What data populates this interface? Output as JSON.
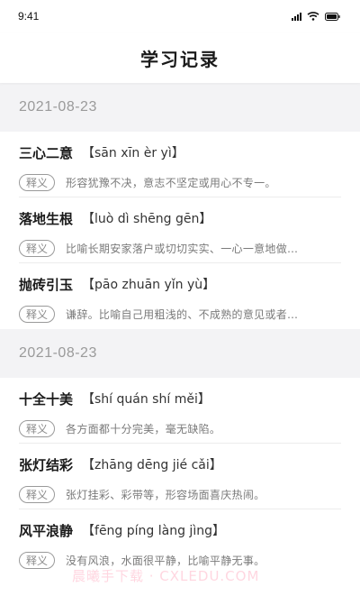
{
  "status_bar": {
    "time": "9:41",
    "icons": [
      "signal-icon",
      "wifi-icon",
      "battery-icon"
    ]
  },
  "header": {
    "title": "学习记录"
  },
  "sections": [
    {
      "date": "2021-08-23",
      "records": [
        {
          "word": "三心二意",
          "pinyin": "【sān xīn èr yì】",
          "tag": "释义",
          "definition": "形容犹豫不决，意志不坚定或用心不专一。"
        },
        {
          "word": "落地生根",
          "pinyin": "【luò dì shēng gēn】",
          "tag": "释义",
          "definition": "比喻长期安家落户或切切实实、一心一意地做…"
        },
        {
          "word": "抛砖引玉",
          "pinyin": "【pāo zhuān yǐn yù】",
          "tag": "释义",
          "definition": "谦辞。比喻自己用粗浅的、不成熟的意见或者…"
        }
      ]
    },
    {
      "date": "2021-08-23",
      "records": [
        {
          "word": "十全十美",
          "pinyin": "【shí quán shí měi】",
          "tag": "释义",
          "definition": "各方面都十分完美，毫无缺陷。"
        },
        {
          "word": "张灯结彩",
          "pinyin": "【zhāng dēng jié cǎi】",
          "tag": "释义",
          "definition": "张灯挂彩、彩带等，形容场面喜庆热闹。"
        },
        {
          "word": "风平浪静",
          "pinyin": "【fēng píng làng jìng】",
          "tag": "释义",
          "definition": "没有风浪，水面很平静，比喻平静无事。"
        }
      ]
    }
  ],
  "watermark": "晨曦手下载 · CXLEDU.COM",
  "colors": {
    "section_bg": "#f3f3f5",
    "date_text": "#9a9a9a",
    "tag_border": "#9a9a9a"
  }
}
